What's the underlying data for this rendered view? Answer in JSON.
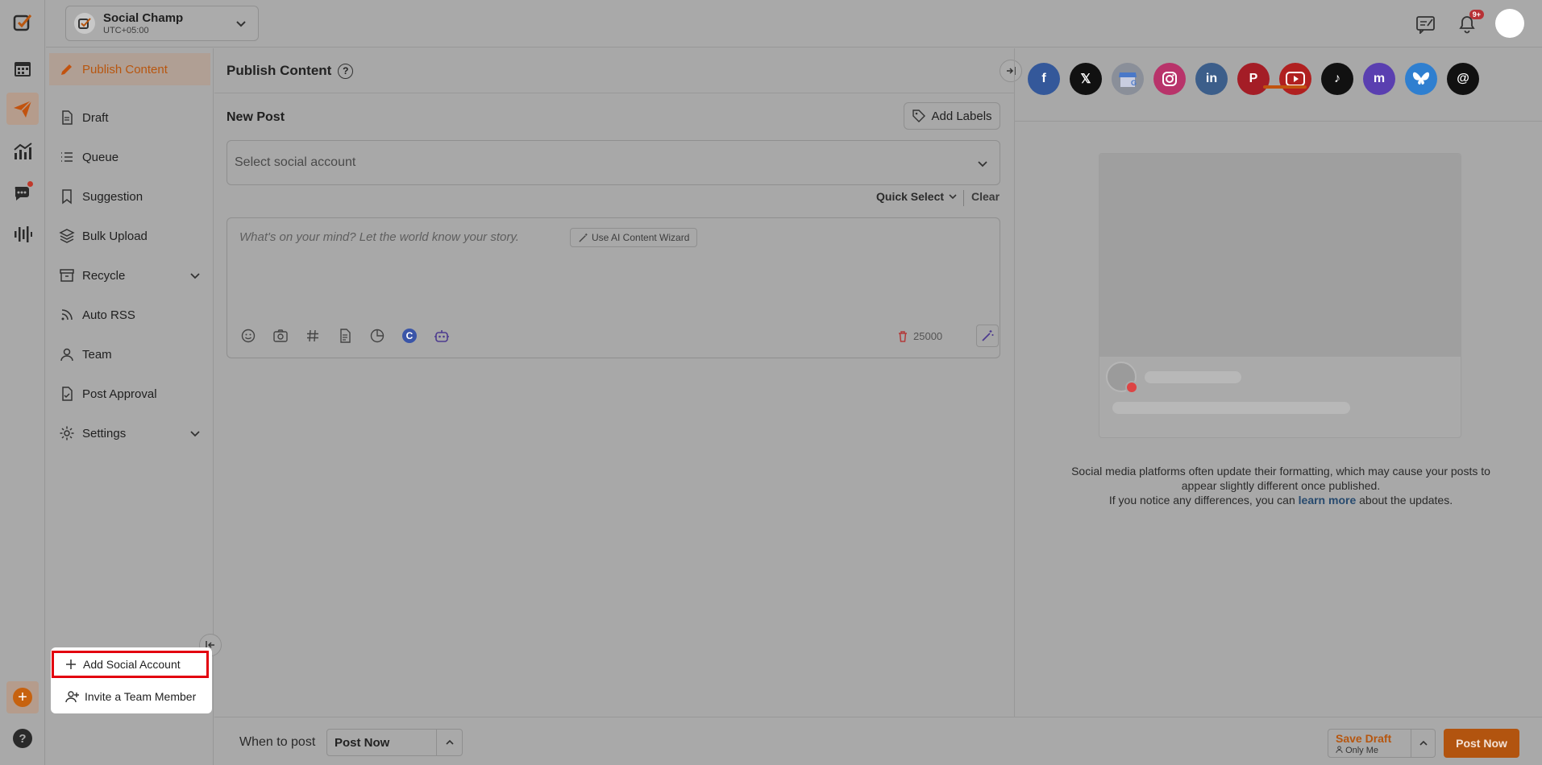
{
  "colors": {
    "accent": "#c2530f",
    "overlay_bg": "#a9a9a9",
    "highlight_border": "#e3000f"
  },
  "workspace": {
    "name": "Social Champ",
    "timezone": "UTC+05:00"
  },
  "header": {
    "notification_badge": "9+"
  },
  "sidebar": {
    "items": [
      {
        "label": "Publish Content",
        "icon": "pencil-icon",
        "active": true
      },
      {
        "label": "Draft",
        "icon": "document-icon"
      },
      {
        "label": "Queue",
        "icon": "list-icon"
      },
      {
        "label": "Suggestion",
        "icon": "bookmark-icon"
      },
      {
        "label": "Bulk Upload",
        "icon": "layers-icon"
      },
      {
        "label": "Recycle",
        "icon": "archive-icon",
        "expandable": true
      },
      {
        "label": "Auto RSS",
        "icon": "rss-icon"
      },
      {
        "label": "Team",
        "icon": "user-icon"
      },
      {
        "label": "Post Approval",
        "icon": "file-check-icon"
      },
      {
        "label": "Settings",
        "icon": "gear-icon",
        "expandable": true
      }
    ]
  },
  "popup_menu": {
    "items": [
      {
        "label": "Add Social Account",
        "icon": "plus-icon",
        "highlighted": true
      },
      {
        "label": "Invite a Team Member",
        "icon": "user-plus-icon"
      }
    ]
  },
  "main": {
    "title": "Publish Content",
    "new_post_label": "New Post",
    "add_labels_button": "Add Labels",
    "account_select_placeholder": "Select social account",
    "quick_select_label": "Quick Select",
    "clear_label": "Clear",
    "editor_placeholder": "What's on your mind? Let the world know your story.",
    "ai_wizard_label": "Use AI Content Wizard",
    "char_limit": "25000",
    "toolbar_icons": [
      "emoji-icon",
      "camera-icon",
      "hashtag-icon",
      "document-icon",
      "pie-chart-icon",
      "canva-icon",
      "robot-icon"
    ]
  },
  "preview": {
    "platforms": [
      {
        "name": "Facebook",
        "icon": "facebook-icon",
        "color": "#34589a"
      },
      {
        "name": "X",
        "icon": "x-icon",
        "color": "#111111"
      },
      {
        "name": "Google Business",
        "icon": "google-business-icon",
        "color": "#8a8f99"
      },
      {
        "name": "Instagram",
        "icon": "instagram-icon",
        "color": "#b8336a"
      },
      {
        "name": "LinkedIn",
        "icon": "linkedin-icon",
        "color": "#3c5e8a"
      },
      {
        "name": "Pinterest",
        "icon": "pinterest-icon",
        "color": "#a41d26"
      },
      {
        "name": "YouTube",
        "icon": "youtube-icon",
        "color": "#b02020",
        "selected": true
      },
      {
        "name": "TikTok",
        "icon": "tiktok-icon",
        "color": "#111111"
      },
      {
        "name": "Mastodon",
        "icon": "mastodon-icon",
        "color": "#5a3fb0"
      },
      {
        "name": "Bluesky",
        "icon": "bluesky-icon",
        "color": "#2f7fd0"
      },
      {
        "name": "Threads",
        "icon": "threads-icon",
        "color": "#111111"
      }
    ],
    "note_line1": "Social media platforms often update their formatting, which may cause your posts to appear slightly different once published.",
    "note_line2_prefix": "If you notice any differences, you can",
    "note_link": "learn more",
    "note_line2_suffix": "about the updates."
  },
  "footer": {
    "when_label": "When to post",
    "when_value": "Post Now",
    "save_draft_label": "Save Draft",
    "visibility_label": "Only Me",
    "post_button": "Post Now"
  }
}
